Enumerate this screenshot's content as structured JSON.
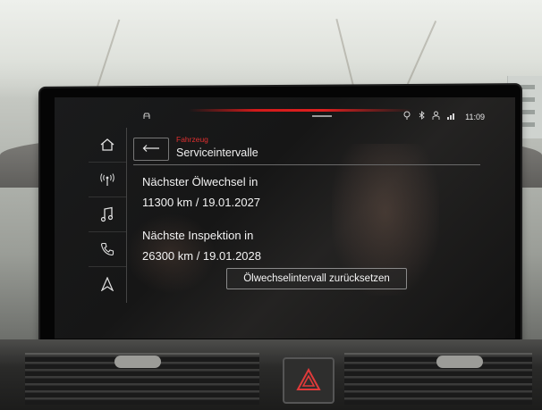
{
  "status_bar": {
    "time": "11:09",
    "icons": [
      "car-icon",
      "navigation-warning-icon",
      "bluetooth-icon",
      "user-icon",
      "signal-icon"
    ]
  },
  "sidebar": {
    "items": [
      {
        "name": "home",
        "icon": "home-icon"
      },
      {
        "name": "radio",
        "icon": "radio-antenna-icon"
      },
      {
        "name": "media",
        "icon": "music-note-icon"
      },
      {
        "name": "phone",
        "icon": "phone-icon"
      },
      {
        "name": "navigation",
        "icon": "navigation-arrow-icon"
      }
    ]
  },
  "header": {
    "breadcrumb": "Fahrzeug",
    "title": "Serviceintervalle",
    "back_icon": "back-arrow-icon"
  },
  "service": {
    "oil_label": "Nächster Ölwechsel in",
    "oil_value": "11300 km / 19.01.2027",
    "inspection_label": "Nächste Inspektion in",
    "inspection_value": "26300 km / 19.01.2028"
  },
  "actions": {
    "reset_label": "Ölwechselintervall zurücksetzen"
  },
  "colors": {
    "accent_red": "#e03030",
    "text": "#f2f2f2",
    "background": "#161616"
  }
}
